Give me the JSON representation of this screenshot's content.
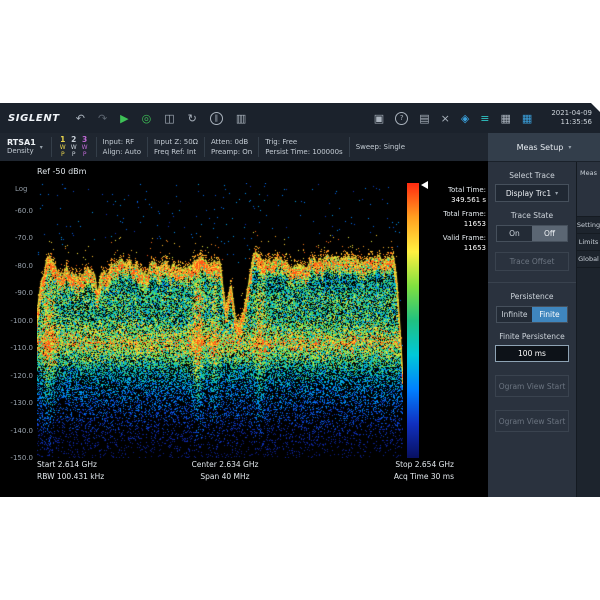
{
  "titlebar": {
    "logo": "SIGLENT",
    "date": "2021-04-09",
    "time": "11:35:56"
  },
  "icons": {
    "undo": "↶",
    "redo": "↷",
    "run": "▶",
    "network": "◎",
    "save": "◫",
    "refresh": "↻",
    "pause": "‖",
    "display": "▥",
    "camera": "▣",
    "help": "?",
    "file": "▤",
    "tools": "×",
    "touch": "◈",
    "list": "≡",
    "keyboard": "▦",
    "calendar": "▦",
    "caret": "▾"
  },
  "statusbar": {
    "mode": "RTSA1",
    "submode": "Density",
    "traces": [
      {
        "n": "1",
        "row1": "W",
        "row2": "P",
        "color": "#e8d44d"
      },
      {
        "n": "2",
        "row1": "W",
        "row2": "P",
        "color": "#c9d1d9"
      },
      {
        "n": "3",
        "row1": "W",
        "row2": "P",
        "color": "#c06ad6"
      }
    ],
    "fields": [
      {
        "l1": "Input: RF",
        "l2": "Align: Auto"
      },
      {
        "l1": "Input Z: 50Ω",
        "l2": "Freq Ref: Int"
      },
      {
        "l1": "Atten: 0dB",
        "l2": "Preamp: On"
      },
      {
        "l1": "Trig: Free",
        "l2": "Persist Time: 100000s"
      },
      {
        "l1": "Sweep: Single",
        "l2": ""
      }
    ]
  },
  "display": {
    "ref_label": "Ref  -50 dBm",
    "scale_label": "Log",
    "y_ticks": [
      "-60.0",
      "-70.0",
      "-80.0",
      "-90.0",
      "-100.0",
      "-110.0",
      "-120.0",
      "-130.0",
      "-140.0",
      "-150.0"
    ],
    "info": [
      {
        "label": "Total Time:",
        "value": "349.561 s"
      },
      {
        "label": "Total Frame:",
        "value": "11653"
      },
      {
        "label": "Valid Frame:",
        "value": "11653"
      }
    ],
    "bottom": {
      "start": "Start  2.614 GHz",
      "rbw": "RBW  100.431 kHz",
      "center": "Center  2.634 GHz",
      "span": "Span  40 MHz",
      "stop": "Stop  2.654 GHz",
      "acq": "Acq Time  30 ms"
    }
  },
  "menu": {
    "title": "Meas Setup",
    "select_trace_label": "Select Trace",
    "trace_dropdown_value": "Display Trc1",
    "trace_state_label": "Trace State",
    "on_label": "On",
    "off_label": "Off",
    "trace_offset_label": "Trace Offset",
    "persistence_label": "Persistence",
    "infinite_label": "Infinite",
    "finite_label": "Finite",
    "finite_persistence_label": "Finite Persistence",
    "finite_persistence_value": "100 ms",
    "ogram_button_1": "Ogram View Start",
    "ogram_button_2": "Ogram View Start"
  },
  "tabs": [
    "Meas",
    "Setting",
    "Limits",
    "Global"
  ],
  "colors": {
    "accent_blue": "#3f86be",
    "selected_gray": "#5b6673",
    "panel_bg": "#2a323e",
    "plot_bg": "#000000"
  },
  "chart_data": {
    "type": "spectrum-density",
    "title": "RTSA1 density persistence spectrum",
    "ref_dbm": -50,
    "db_per_div": 10,
    "y_range_dbm": [
      -150,
      -50
    ],
    "x_range_ghz": [
      2.614,
      2.654
    ],
    "center_ghz": 2.634,
    "span_mhz": 40,
    "rbw_khz": 100.431,
    "acq_time_ms": 30,
    "total_time_s": 349.561,
    "total_frame": 11653,
    "valid_frame": 11653,
    "envelope": [
      [
        0.0,
        -96
      ],
      [
        0.01,
        -84
      ],
      [
        0.03,
        -76
      ],
      [
        0.05,
        -80
      ],
      [
        0.1,
        -81
      ],
      [
        0.155,
        -82
      ],
      [
        0.165,
        -88
      ],
      [
        0.175,
        -82
      ],
      [
        0.25,
        -80
      ],
      [
        0.35,
        -80
      ],
      [
        0.43,
        -79
      ],
      [
        0.465,
        -77
      ],
      [
        0.5,
        -79
      ],
      [
        0.515,
        -96
      ],
      [
        0.53,
        -90
      ],
      [
        0.545,
        -101
      ],
      [
        0.565,
        -97
      ],
      [
        0.578,
        -86
      ],
      [
        0.59,
        -79
      ],
      [
        0.61,
        -76
      ],
      [
        0.65,
        -79
      ],
      [
        0.72,
        -80
      ],
      [
        0.8,
        -78
      ],
      [
        0.86,
        -77
      ],
      [
        0.93,
        -78
      ],
      [
        0.975,
        -78
      ],
      [
        0.985,
        -84
      ],
      [
        0.993,
        -102
      ],
      [
        1.0,
        -120
      ]
    ],
    "intensity_profile": [
      [
        -50,
        0.0
      ],
      [
        -76,
        0.15
      ],
      [
        -80,
        0.3
      ],
      [
        -86,
        0.42
      ],
      [
        -92,
        0.55
      ],
      [
        -97,
        0.5
      ],
      [
        -103,
        0.62
      ],
      [
        -108,
        0.8
      ],
      [
        -113,
        0.6
      ],
      [
        -118,
        0.42
      ],
      [
        -124,
        0.3
      ],
      [
        -132,
        0.2
      ],
      [
        -140,
        0.12
      ],
      [
        -150,
        0.05
      ]
    ],
    "hotspots": [
      {
        "x": 0.03,
        "w": 0.012,
        "boost": 0.5
      },
      {
        "x": 0.44,
        "w": 0.01,
        "boost": 0.55
      },
      {
        "x": 0.485,
        "w": 0.008,
        "boost": 0.3
      },
      {
        "x": 0.61,
        "w": 0.01,
        "boost": 0.35
      }
    ],
    "trace_color": "#e8e03a",
    "colorbar_stops": [
      "#ff2a10",
      "#ffa020",
      "#fff040",
      "#80e040",
      "#20c080",
      "#00c8d8",
      "#0080ff",
      "#1030c0",
      "#081060"
    ]
  }
}
